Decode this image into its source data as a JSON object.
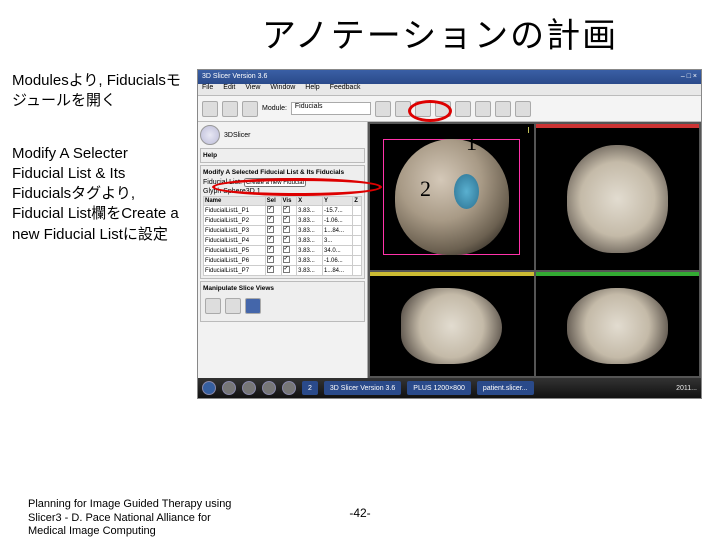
{
  "title": "アノテーションの計画",
  "instructions": {
    "step1": "Modulesより, Fiducialsモジュールを開く",
    "step2": "Modify A Selecter Fiducial List & Its Fiducialsタグより, Fiducial List欄をCreate a new Fiducial Listに設定"
  },
  "callouts": {
    "one": "1",
    "two": "2"
  },
  "app": {
    "window_title": "3D Slicer Version 3.6",
    "menu": [
      "File",
      "Edit",
      "View",
      "Window",
      "Help",
      "Feedback"
    ],
    "toolbar": {
      "module_label": "Module:",
      "module_value": "Fiducials"
    },
    "logo_text": "3DSlicer",
    "panel": {
      "section_head": "Modify A Selected Fiducial List & Its Fiducials",
      "fiducial_list_label": "Fiducial List:",
      "fiducial_list_value": "Create a new Fiducial List",
      "glyph_row": "Glyph  Sphere3D    1",
      "table": {
        "headers": [
          "Name",
          "Sel",
          "Vis",
          "X",
          "Y",
          "Z"
        ],
        "rows": [
          [
            "FiducialList1_P1",
            "✓",
            "✓",
            "3.83...",
            "-15.7...",
            ""
          ],
          [
            "FiducialList1_P2",
            "✓",
            "✓",
            "3.83...",
            "-1.06...",
            ""
          ],
          [
            "FiducialList1_P3",
            "✓",
            "✓",
            "3.83...",
            "1...84...",
            ""
          ],
          [
            "FiducialList1_P4",
            "✓",
            "✓",
            "3.83...",
            "3...",
            ""
          ],
          [
            "FiducialList1_P5",
            "✓",
            "✓",
            "3.83...",
            "34.0...",
            ""
          ],
          [
            "FiducialList1_P6",
            "✓",
            "✓",
            "3.83...",
            "-1.06...",
            ""
          ],
          [
            "FiducialList1_P7",
            "✓",
            "✓",
            "3.83...",
            "1...84...",
            ""
          ]
        ]
      },
      "manip_head": "Manipulate Slice Views"
    },
    "taskbar": {
      "tabs": [
        "2",
        "3D Slicer Version 3.6",
        "PLUS 1200×800",
        "patient.slicer..."
      ],
      "clock": "2011..."
    }
  },
  "footer": "Planning for Image Guided Therapy using Slicer3 - D. Pace National Alliance for Medical Image Computing",
  "page_number": "-42-"
}
